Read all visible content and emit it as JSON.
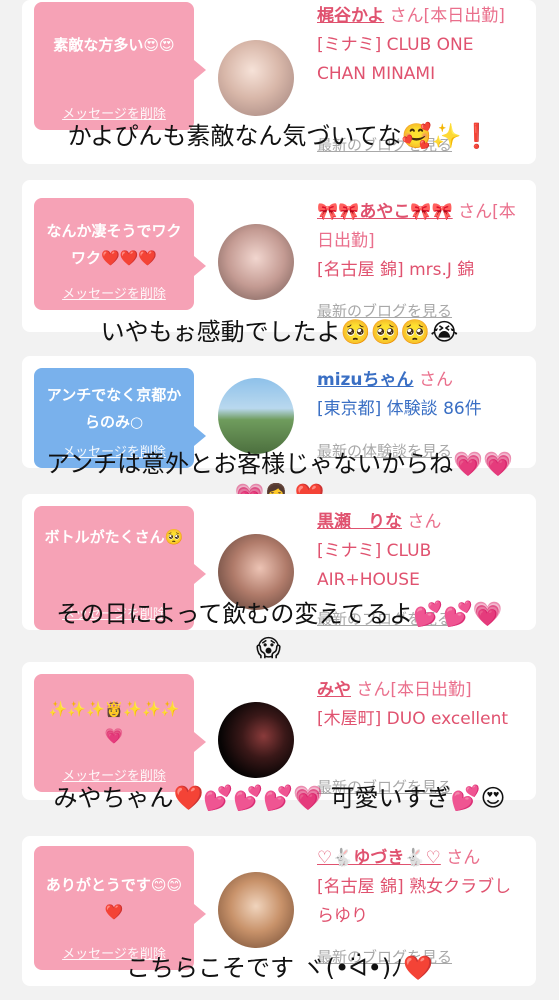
{
  "messages": [
    {
      "bubble_text": "素敵な方多い😍😍",
      "delete_label": "メッセージを削除",
      "name": "梶谷かよ",
      "suffix": "さん[本日出勤]",
      "meta": "[ミナミ] CLUB ONE CHAN MINAMI",
      "blog_label": "最新のブログを見る",
      "reply": "かよぴんも素敵なん気づいてな🥰✨❗",
      "reply2": ""
    },
    {
      "bubble_text": "なんか凄そうでワクワク❤️❤️❤️",
      "delete_label": "メッセージを削除",
      "name": "🎀🎀あやこ🎀🎀",
      "suffix": "さん[本日出勤]",
      "meta": "[名古屋 錦] mrs.J 錦",
      "blog_label": "最新のブログを見る",
      "reply": "いやもぉ感動でしたよ🥺🥺🥺😭",
      "reply2": ""
    },
    {
      "bubble_text": "アンチでなく京都からのみ○",
      "delete_label": "メッセージを削除",
      "name": "mizuちゃん",
      "suffix": "さん",
      "meta": "[東京都] 体験談 86件",
      "blog_label": "最新の体験談を見る",
      "reply": "アンチは意外とお客様じゃないからね💗💗",
      "reply2": "💗💁‍♀️❤️"
    },
    {
      "bubble_text": "ボトルがたくさん🥺",
      "delete_label": "メッセージを削除",
      "name": "黒瀬　りな",
      "suffix": "さん",
      "meta": "[ミナミ] CLUB AIR+HOUSE",
      "blog_label": "最新のブログを見る",
      "reply": "その日によって飲むの変えてるよ💕💕💗",
      "reply2": "😱"
    },
    {
      "bubble_text": "✨✨✨👸✨✨✨💗",
      "delete_label": "メッセージを削除",
      "name": "みや",
      "suffix": "さん[本日出勤]",
      "meta": "[木屋町] DUO excellent",
      "blog_label": "最新のブログを見る",
      "reply": "みやちゃん❤️💕💕💕💗 可愛いすぎ💕😍",
      "reply2": ""
    },
    {
      "bubble_text": "ありがとうです😊😊❤️",
      "delete_label": "メッセージを削除",
      "name": "♡🐇ゆづき🐇♡",
      "suffix": "さん",
      "meta": "[名古屋 錦] 熟女クラブしらゆり",
      "blog_label": "最新のブログを見る",
      "reply": "こちらこそです ヾ(•ᐛ•)ﾉ❤️",
      "reply2": ""
    }
  ],
  "colors": {
    "pink_bubble": "#f6a2b6",
    "blue_bubble": "#79b1ec",
    "name_pink": "#e0526f",
    "name_blue": "#3a6fc4",
    "background": "#f2f2f2"
  }
}
